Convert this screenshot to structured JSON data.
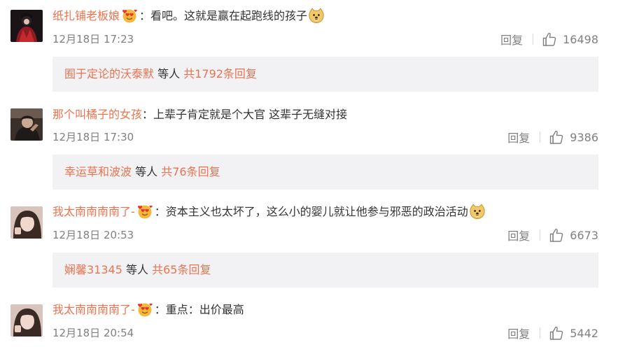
{
  "comments": [
    {
      "username": "纸扎铺老板娘",
      "verified_badge": "heart-eyes-badge-icon",
      "separator": "：",
      "text": "看吧。这就是赢在起跑线的孩子",
      "emoji": "doge-emoji-icon",
      "timestamp": "12月18日 17:23",
      "reply_label": "回复",
      "like_count": "16498",
      "replies_preview": {
        "name": "囿于定论的沃泰默",
        "mid": " 等人 ",
        "count": "共1792条回复"
      }
    },
    {
      "username": "那个叫橘子的女孩",
      "separator": "：",
      "text": "上辈子肯定就是个大官  这辈子无缝对接",
      "timestamp": "12月18日 17:30",
      "reply_label": "回复",
      "like_count": "9386",
      "replies_preview": {
        "name": "幸运草和波波",
        "mid": " 等人 ",
        "count": "共76条回复"
      }
    },
    {
      "username": "我太南南南南了-",
      "verified_badge": "heart-eyes-badge-icon",
      "separator": "：",
      "text": "资本主义也太坏了，这么小的婴儿就让他参与邪恶的政治活动",
      "emoji": "doge-emoji-icon",
      "timestamp": "12月18日 20:53",
      "reply_label": "回复",
      "like_count": "6673",
      "replies_preview": {
        "name": "娴馨31345",
        "mid": " 等人 ",
        "count": "共65条回复"
      }
    },
    {
      "username": "我太南南南南了-",
      "verified_badge": "heart-eyes-badge-icon",
      "separator": "：",
      "text": "重点：出价最高",
      "timestamp": "12月18日 20:54",
      "reply_label": "回复",
      "like_count": "5442"
    }
  ],
  "colors": {
    "username": "#eb7350",
    "text": "#333333",
    "meta": "#808080",
    "reply_box_bg": "#f2f2f5"
  }
}
